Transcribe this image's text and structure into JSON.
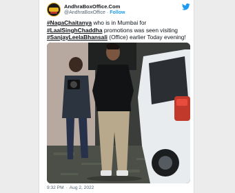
{
  "tweet": {
    "account_name": "AndhraBoxOffice.Com",
    "handle": "@AndhraBoxOffice",
    "follow_label": "Follow",
    "text_lines": [
      {
        "tag": "#NagaChaitanya",
        "rest": " who is in Mumbai for"
      },
      {
        "tag": "#LaalSinghChaddha",
        "rest": " promotions was seen visiting"
      },
      {
        "tag": "#SanjayLeelaBhansali",
        "rest": " (Office) earlier Today evening!"
      }
    ],
    "time": "9:32 PM",
    "date": "Aug 2, 2022"
  },
  "icons": {
    "brand": "twitter-bird-icon",
    "avatar": "andhraboxoffice-logo"
  },
  "colors": {
    "accent": "#1d9bf0",
    "text": "#0f1419",
    "muted": "#536471"
  }
}
